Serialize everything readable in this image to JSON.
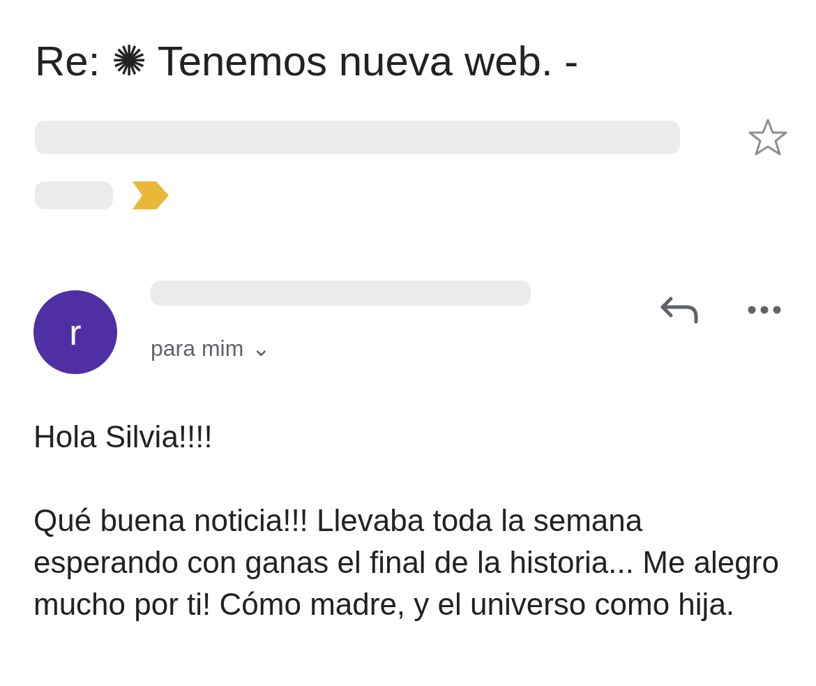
{
  "subject": {
    "text": "Re: ✺ Tenemos nueva web. -",
    "starred": false,
    "important": true
  },
  "message": {
    "avatar": {
      "letter": "r",
      "color": "#4f2fa3"
    },
    "recipient": "para mim",
    "recipient_caret": "⌄",
    "body": [
      "Hola Silvia!!!!",
      "Qué buena noticia!!! Llevaba toda la semana esperando con ganas el final de la historia... Me alegro mucho por ti! Cómo madre, y el universo como hija."
    ]
  }
}
